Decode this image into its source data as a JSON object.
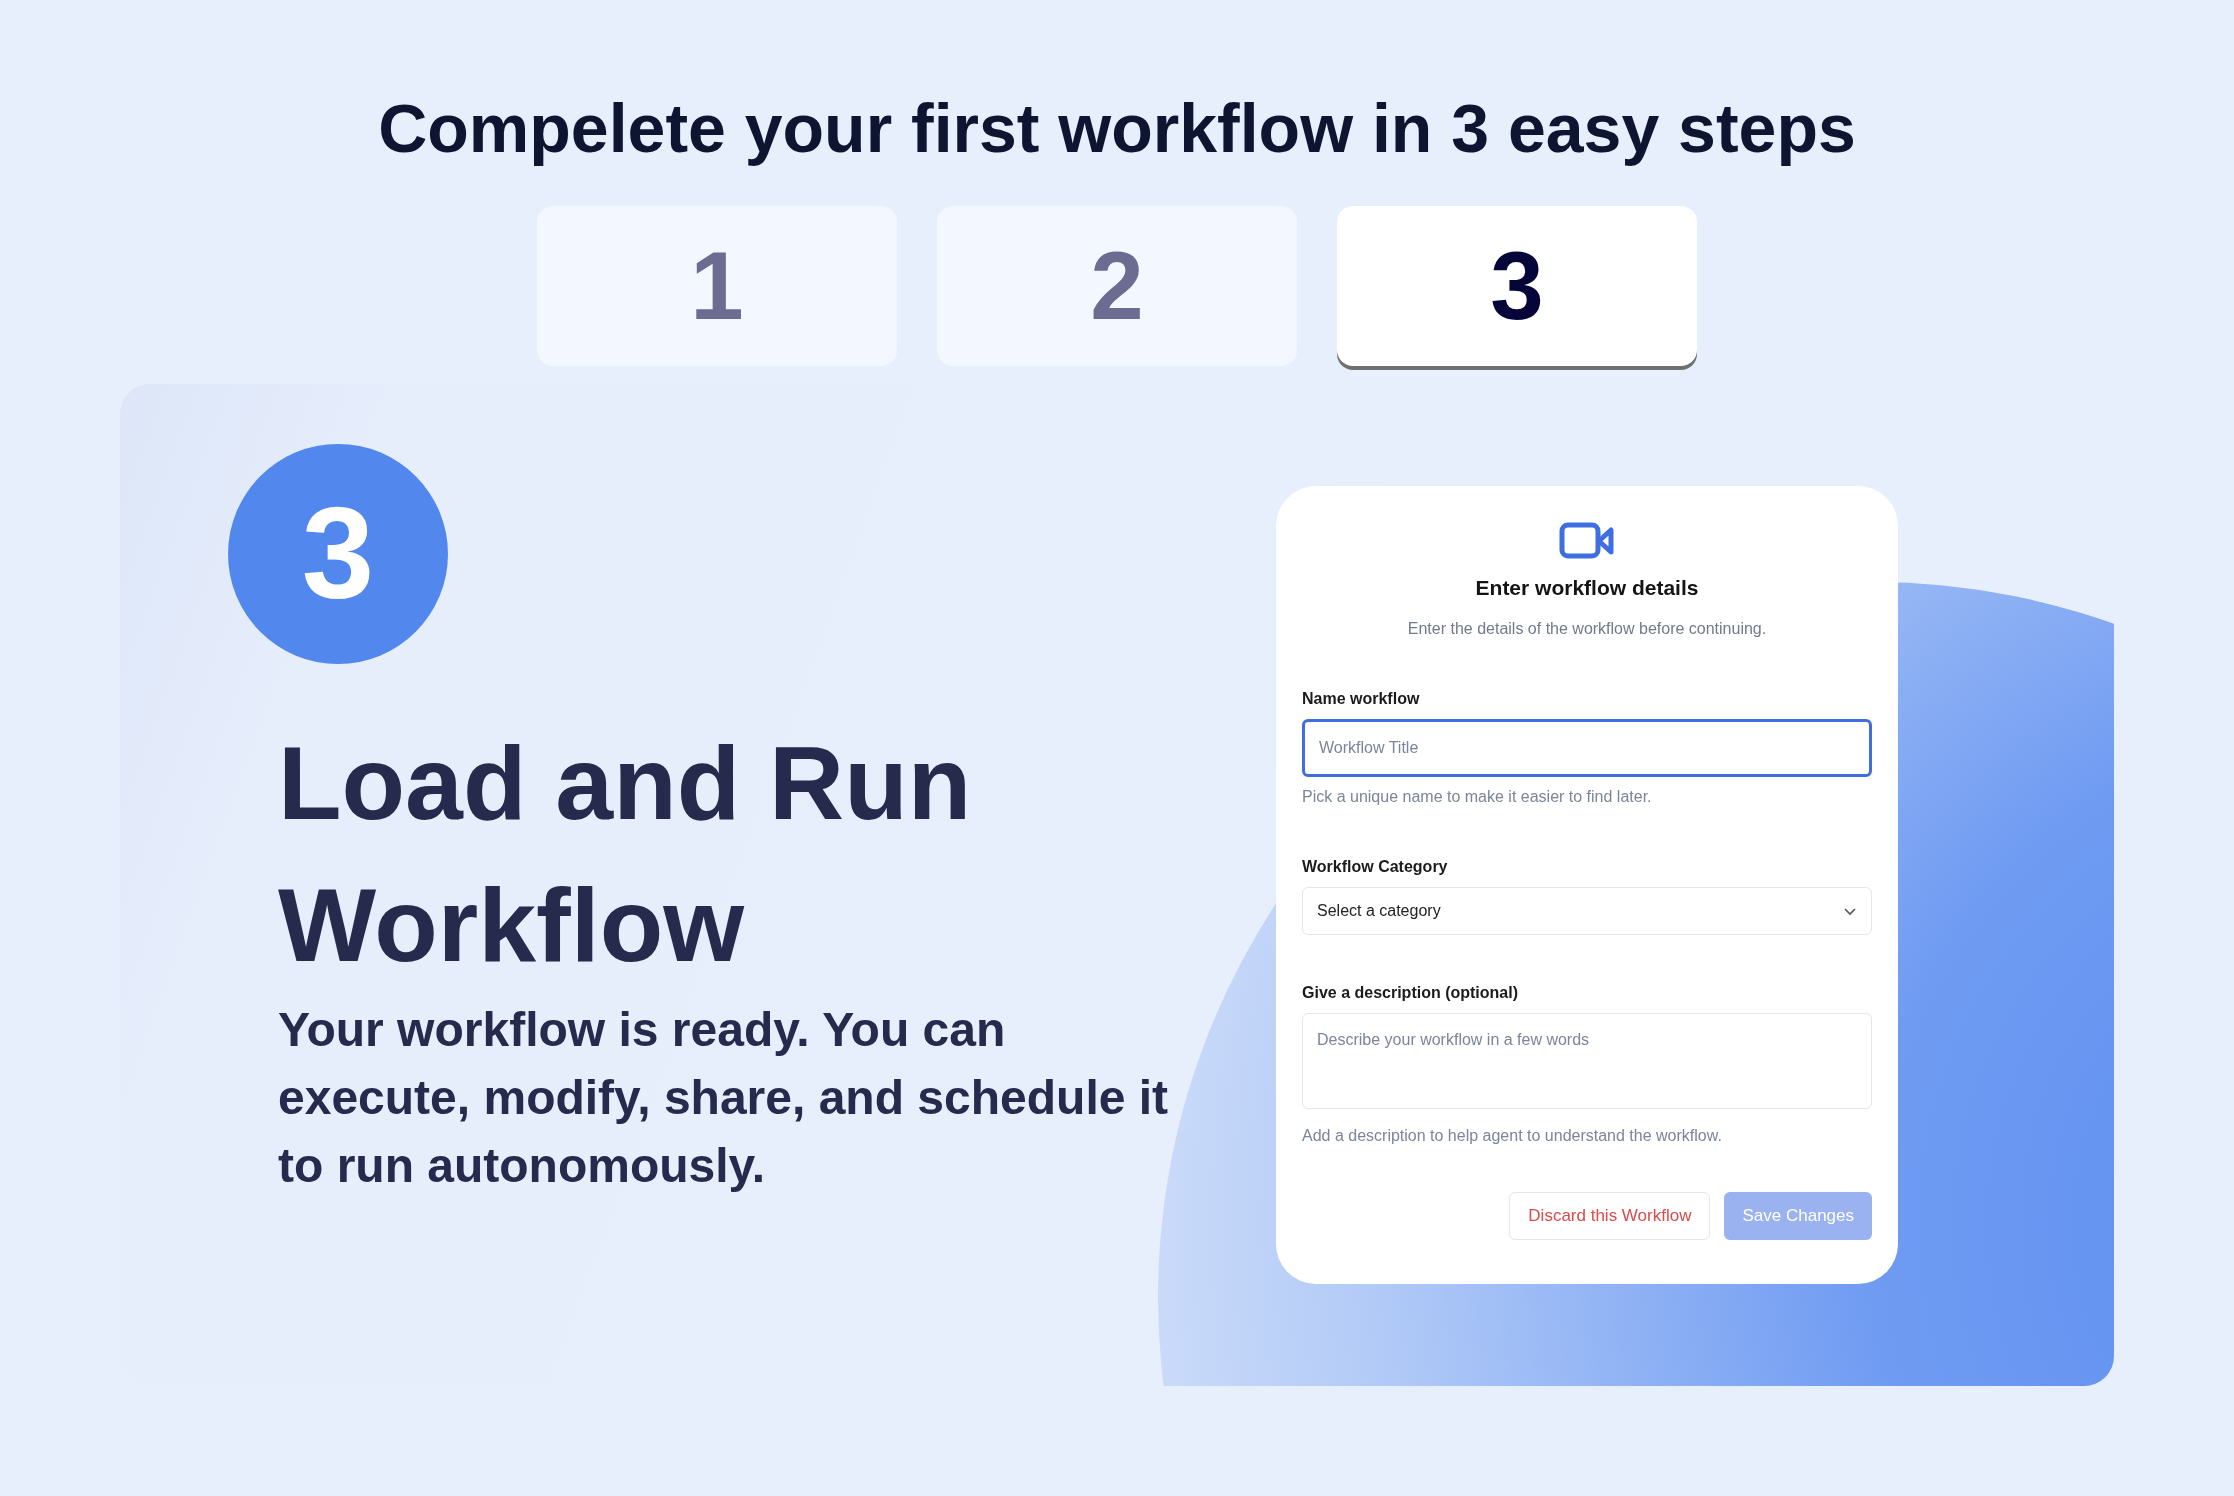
{
  "heading": "Compelete your first workflow in 3 easy steps",
  "steps": [
    {
      "label": "1",
      "selected": false
    },
    {
      "label": "2",
      "selected": false
    },
    {
      "label": "3",
      "selected": true
    }
  ],
  "step_badge": "3",
  "title": "Load and Run Workflow",
  "description": "Your workflow is ready. You can execute, modify, share, and schedule it to run autonomously.",
  "form": {
    "title": "Enter workflow details",
    "subtitle": "Enter the details of the workflow before continuing.",
    "fields": [
      {
        "kind": "text",
        "label": "Name workflow",
        "placeholder": "Workflow Title",
        "help": "Pick a unique name to make it easier to find later.",
        "focused": true
      },
      {
        "kind": "select",
        "label": "Workflow Category",
        "value": "Select a category",
        "focused": false
      },
      {
        "kind": "textarea",
        "label": "Give a description (optional)",
        "placeholder": "Describe your workflow in a few words",
        "help": "Add a description to help agent to understand the workflow.",
        "focused": false
      }
    ],
    "buttons": [
      {
        "kind": "danger",
        "label": "Discard this Workflow"
      },
      {
        "kind": "primary",
        "label": "Save Changes",
        "disabled": true
      }
    ]
  }
}
